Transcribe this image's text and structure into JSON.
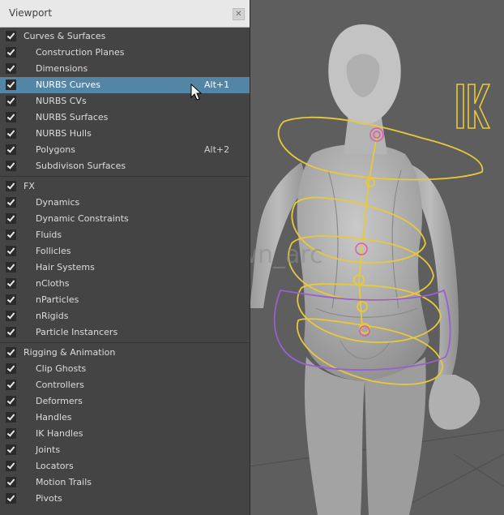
{
  "window": {
    "title": "Viewport"
  },
  "groups": [
    {
      "label": "Curves & Surfaces",
      "checked": true,
      "items": [
        {
          "label": "Construction Planes",
          "checked": true,
          "shortcut": ""
        },
        {
          "label": "Dimensions",
          "checked": true,
          "shortcut": ""
        },
        {
          "label": "NURBS Curves",
          "checked": true,
          "shortcut": "Alt+1",
          "highlighted": true
        },
        {
          "label": "NURBS CVs",
          "checked": true,
          "shortcut": ""
        },
        {
          "label": "NURBS Surfaces",
          "checked": true,
          "shortcut": ""
        },
        {
          "label": "NURBS Hulls",
          "checked": true,
          "shortcut": ""
        },
        {
          "label": "Polygons",
          "checked": true,
          "shortcut": "Alt+2"
        },
        {
          "label": "Subdivison Surfaces",
          "checked": true,
          "shortcut": ""
        }
      ]
    },
    {
      "label": "FX",
      "checked": true,
      "items": [
        {
          "label": "Dynamics",
          "checked": true,
          "shortcut": ""
        },
        {
          "label": "Dynamic Constraints",
          "checked": true,
          "shortcut": ""
        },
        {
          "label": "Fluids",
          "checked": true,
          "shortcut": ""
        },
        {
          "label": "Follicles",
          "checked": true,
          "shortcut": ""
        },
        {
          "label": "Hair Systems",
          "checked": true,
          "shortcut": ""
        },
        {
          "label": "nCloths",
          "checked": true,
          "shortcut": ""
        },
        {
          "label": "nParticles",
          "checked": true,
          "shortcut": ""
        },
        {
          "label": "nRigids",
          "checked": true,
          "shortcut": ""
        },
        {
          "label": "Particle Instancers",
          "checked": true,
          "shortcut": ""
        }
      ]
    },
    {
      "label": "Rigging & Animation",
      "checked": true,
      "items": [
        {
          "label": "Clip Ghosts",
          "checked": true,
          "shortcut": ""
        },
        {
          "label": "Controllers",
          "checked": true,
          "shortcut": ""
        },
        {
          "label": "Deformers",
          "checked": true,
          "shortcut": ""
        },
        {
          "label": "Handles",
          "checked": true,
          "shortcut": ""
        },
        {
          "label": "IK Handles",
          "checked": true,
          "shortcut": ""
        },
        {
          "label": "Joints",
          "checked": true,
          "shortcut": ""
        },
        {
          "label": "Locators",
          "checked": true,
          "shortcut": ""
        },
        {
          "label": "Motion Trails",
          "checked": true,
          "shortcut": ""
        },
        {
          "label": "Pivots",
          "checked": true,
          "shortcut": ""
        }
      ]
    }
  ],
  "viewport": {
    "watermark": "@dawn_arc",
    "ik_label": "IK"
  },
  "colors": {
    "highlight": "#5285a6",
    "controller_yellow": "#e8c93a",
    "controller_purple": "#9a5fd0",
    "joint_pink": "#e05aa0"
  },
  "icons": {
    "close": "close-icon",
    "checkbox": "checkmark-icon",
    "cursor": "mouse-pointer-icon"
  }
}
